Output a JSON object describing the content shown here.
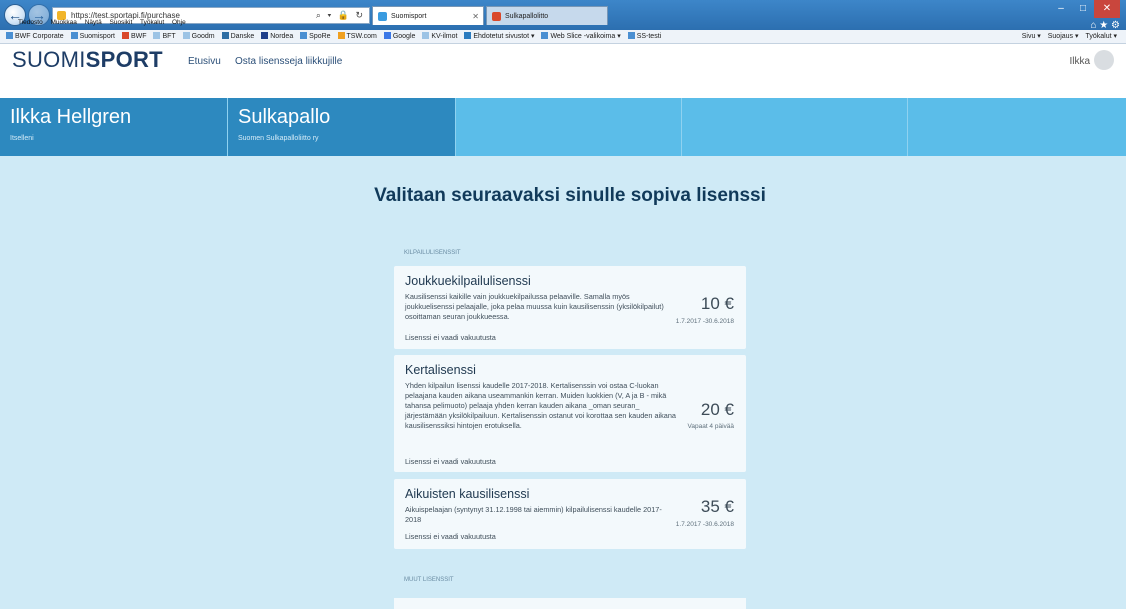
{
  "browser": {
    "url": "https://test.sportapi.fi/purchase",
    "address_controls": "⌕ ▾ 🔒 ↻",
    "tabs": [
      {
        "label": "Suomisport",
        "close": "✕"
      },
      {
        "label": "Sulkapallolitto"
      }
    ],
    "menu": [
      "Tiedosto",
      "Muokkaa",
      "Näytä",
      "Suosikit",
      "Työkalut",
      "Ohje"
    ],
    "favorites": [
      "BWF Corporate",
      "Suomisport",
      "BWF",
      "BFT",
      "Goodm",
      "Danske",
      "Nordea",
      "SpoRe",
      "TSW.com",
      "Google",
      "KV-ilmot",
      "Ehdotetut sivustot ▾",
      "Web Slice -valikoima ▾",
      "SS-testi"
    ],
    "command_bar": [
      "Sivu ▾",
      "Suojaus ▾",
      "Työkalut ▾"
    ],
    "window_controls": {
      "minimize": "–",
      "maximize": "□",
      "close": "✕"
    },
    "right_icons": "⌂ ★ ⚙"
  },
  "site": {
    "logo_light": "SUOMI",
    "logo_bold": "SPORT",
    "nav": [
      "Etusivu",
      "Osta lisensseja liikkujille"
    ],
    "user_name": "Ilkka"
  },
  "band": {
    "person": {
      "name": "Ilkka Hellgren",
      "sub": "Itselleni"
    },
    "sport": {
      "name": "Sulkapallo",
      "sub": "Suomen Sulkapalloliitto ry"
    }
  },
  "main": {
    "heading": "Valitaan seuraavaksi sinulle sopiva lisenssi",
    "section_competition": "KILPAILULISENSSIT",
    "section_other": "MUUT LISENSSIT",
    "licenses": [
      {
        "title": "Joukkuekilpailulisenssi",
        "description": "Kausilisenssi kaikille vain joukkuekilpailussa pelaaville. Samalla myös joukkuelisenssi pelaajalle, joka pelaa muussa kuin kausilisenssin (yksilökilpailut) osoittaman seuran joukkueessa.",
        "price": "10 €",
        "period": "1.7.2017 -30.6.2018",
        "note": "Lisenssi ei vaadi vakuutusta"
      },
      {
        "title": "Kertalisenssi",
        "description": "Yhden kilpailun lisenssi kaudelle 2017-2018. Kertalisenssin voi ostaa C-luokan pelaajana kauden aikana useammankin kerran. Muiden luokkien (V, A ja B - mikä tahansa pelimuoto) pelaaja yhden kerran kauden aikana _oman seuran_ järjestämään yksilökilpailuun. Kertalisenssin ostanut voi korottaa sen kauden aikana kausilisenssiksi hintojen erotuksella.",
        "price": "20 €",
        "period": "Vapaat 4 päivää",
        "note": "Lisenssi ei vaadi vakuutusta"
      },
      {
        "title": "Aikuisten kausilisenssi",
        "description": "Aikuispelaajan (syntynyt 31.12.1998 tai aiemmin) kilpailulisenssi kaudelle 2017-2018",
        "price": "35 €",
        "period": "1.7.2017 -30.6.2018",
        "note": "Lisenssi ei vaadi vakuutusta"
      }
    ]
  }
}
